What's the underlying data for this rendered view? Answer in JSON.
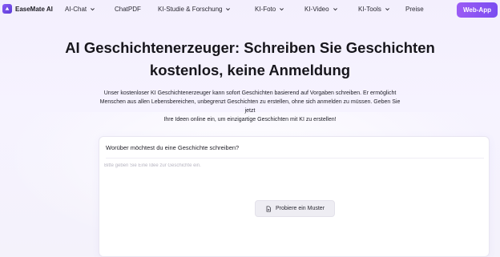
{
  "brand": {
    "name": "EaseMate AI"
  },
  "nav": {
    "items": [
      {
        "label": "AI-Chat",
        "has_dropdown": true
      },
      {
        "label": "ChatPDF",
        "has_dropdown": false
      },
      {
        "label": "KI-Studie & Forschung",
        "has_dropdown": true
      },
      {
        "label": "KI-Foto",
        "has_dropdown": true
      },
      {
        "label": "KI-Video",
        "has_dropdown": true
      },
      {
        "label": "KI-Tools",
        "has_dropdown": true
      },
      {
        "label": "Preise",
        "has_dropdown": false
      }
    ],
    "cta_label": "Web-App"
  },
  "hero": {
    "title_line1": "AI Geschichtenerzeuger: Schreiben Sie Geschichten",
    "title_line2": "kostenlos, keine Anmeldung",
    "subtitle_line1": "Unser kostenloser KI Geschichtenerzeuger kann sofort Geschichten basierend auf Vorgaben schreiben. Er ermöglicht",
    "subtitle_line2": "Menschen aus allen Lebensbereichen, unbegrenzt Geschichten zu erstellen, ohne sich anmelden zu müssen. Geben Sie jetzt",
    "subtitle_line3": "Ihre Ideen online ein, um einzigartige Geschichten mit KI zu erstellen!"
  },
  "form": {
    "label": "Worüber möchtest du eine Geschichte schreiben?",
    "placeholder": "Bitte geben Sie Eine Idee zur Geschichte ein.",
    "value": "",
    "example_button_label": "Probiere ein Muster"
  },
  "colors": {
    "accent": "#8a5cf6",
    "cta_start": "#9b5cf5",
    "cta_end": "#7a4cf0"
  }
}
